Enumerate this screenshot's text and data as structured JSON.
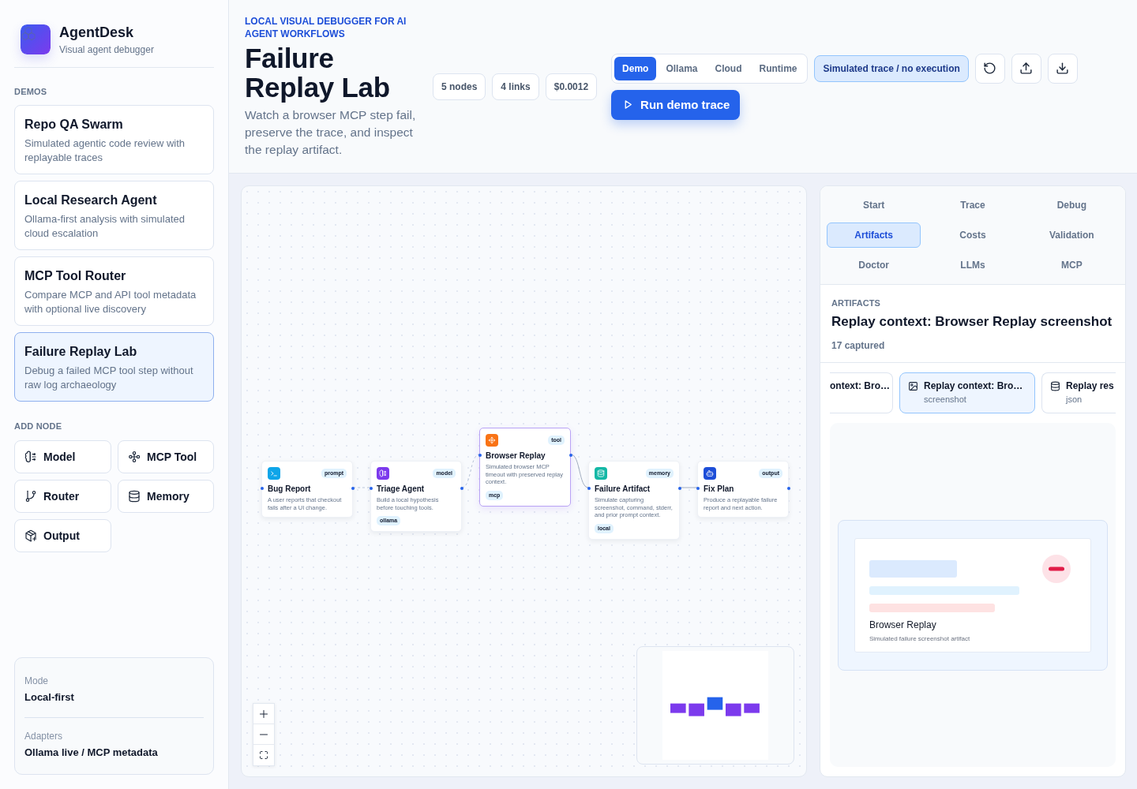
{
  "brand": {
    "name": "AgentDesk",
    "tagline": "Visual agent debugger"
  },
  "sidebar": {
    "demos_label": "DEMOS",
    "demos": [
      {
        "title": "Repo QA Swarm",
        "description": "Simulated agentic code review with replayable traces",
        "selected": false
      },
      {
        "title": "Local Research Agent",
        "description": "Ollama-first analysis with simulated cloud escalation",
        "selected": false
      },
      {
        "title": "MCP Tool Router",
        "description": "Compare MCP and API tool metadata with optional live discovery",
        "selected": false
      },
      {
        "title": "Failure Replay Lab",
        "description": "Debug a failed MCP tool step without raw log archaeology",
        "selected": true
      }
    ],
    "add_node_label": "ADD NODE",
    "add_node_buttons": [
      {
        "kind": "model",
        "label": "Model"
      },
      {
        "kind": "tool",
        "label": "MCP Tool"
      },
      {
        "kind": "router",
        "label": "Router"
      },
      {
        "kind": "memory",
        "label": "Memory"
      },
      {
        "kind": "output",
        "label": "Output"
      }
    ],
    "info": [
      {
        "label": "Mode",
        "value": "Local-first"
      },
      {
        "label": "Adapters",
        "value": "Ollama live / MCP metadata"
      }
    ]
  },
  "header": {
    "eyebrow": "LOCAL VISUAL DEBUGGER FOR AI AGENT WORKFLOWS",
    "title": "Failure Replay Lab",
    "description": "Watch a browser MCP step fail, preserve the trace, and inspect the replay artifact.",
    "stats": [
      "5 nodes",
      "4 links",
      "$0.0012"
    ],
    "modes": [
      {
        "label": "Demo",
        "selected": true
      },
      {
        "label": "Ollama",
        "selected": false
      },
      {
        "label": "Cloud",
        "selected": false
      },
      {
        "label": "Runtime",
        "selected": false
      }
    ],
    "trace_badge": "Simulated trace / no execution",
    "run_button": "Run demo trace"
  },
  "canvas": {
    "nodes": [
      {
        "kind": "prompt",
        "tag": "prompt",
        "title": "Bug Report",
        "description": "A user reports that checkout fails after a UI change.",
        "color": "#0ea5e9",
        "selected": false
      },
      {
        "kind": "model",
        "tag": "model",
        "title": "Triage Agent",
        "description": "Build a local hypothesis before touching tools.",
        "chip": "ollama",
        "color": "#7c3aed",
        "selected": false
      },
      {
        "kind": "tool",
        "tag": "tool",
        "title": "Browser Replay",
        "description": "Simulated browser MCP timeout with preserved replay context.",
        "chip": "mcp",
        "color": "#f97316",
        "selected": true
      },
      {
        "kind": "memory",
        "tag": "memory",
        "title": "Failure Artifact",
        "description": "Simulate capturing screenshot, command, stderr, and prior prompt context.",
        "chip": "local",
        "color": "#14b8a6",
        "selected": false
      },
      {
        "kind": "output",
        "tag": "output",
        "title": "Fix Plan",
        "description": "Produce a replayable failure report and next action.",
        "color": "#1d4ed8",
        "selected": false
      }
    ],
    "edges": [
      {
        "kind": "dashed"
      },
      {
        "kind": "dashed"
      },
      {
        "kind": "solid"
      },
      {
        "kind": "solid"
      }
    ]
  },
  "inspector": {
    "tabs": [
      {
        "label": "Start",
        "selected": false
      },
      {
        "label": "Trace",
        "selected": false
      },
      {
        "label": "Debug",
        "selected": false
      },
      {
        "label": "Artifacts",
        "selected": true
      },
      {
        "label": "Costs",
        "selected": false
      },
      {
        "label": "Validation",
        "selected": false
      },
      {
        "label": "Doctor",
        "selected": false
      },
      {
        "label": "LLMs",
        "selected": false
      },
      {
        "label": "MCP",
        "selected": false
      }
    ],
    "section_label": "ARTIFACTS",
    "title": "Replay context: Browser Replay screenshot",
    "count": "17 captured",
    "artifacts": [
      {
        "title": "ontext: Bro…",
        "selected": false
      },
      {
        "kind": "image",
        "title": "Replay context: Bro…",
        "type": "screenshot",
        "selected": true
      },
      {
        "kind": "data",
        "title": "Replay res",
        "type": "json",
        "selected": false
      }
    ],
    "preview": {
      "title": "Browser Replay",
      "caption": "Simulated failure screenshot artifact"
    }
  }
}
